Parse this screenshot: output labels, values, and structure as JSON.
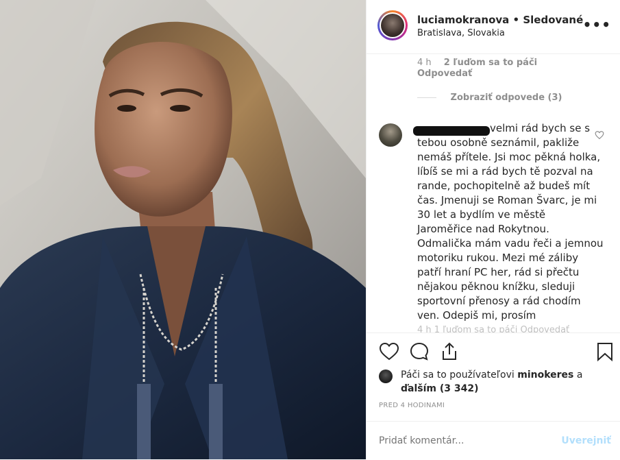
{
  "post": {
    "username": "luciamokranova",
    "separator": "•",
    "follow_status": "Sledované",
    "location": "Bratislava, Slovakia",
    "more_label": "•••"
  },
  "comments": {
    "prev_time": "4 h",
    "prev_likes": "2 ľuďom sa to páči",
    "reply_label": "Odpovedať",
    "view_replies": "Zobraziť odpovede (3)",
    "main_comment": "velmi rád bych se s tebou osobně seznámil, pakliže nemáš přítele. Jsi moc pěkná holka, líbíš se mi a rád bych tě pozval na rande, pochopitelně až budeš mít čas. Jmenuji se Roman Švarc, je mi 30 let a bydlím ve městě Jaroměřice nad Rokytnou. Odmalička mám vadu řeči a jemnou motoriku rukou. Mezi mé záliby patří hraní PC her, rád si přečtu nějakou pěknou knížku, sleduji sportovní přenosy a rád chodím ven. Odepiš mi, prosím",
    "faded_row": "4 h   1 ľuďom sa to páči   Odpovedať"
  },
  "likes": {
    "prefix": "Páči sa to používateľovi ",
    "user": "minokeres",
    "middle": " a ",
    "others": "ďalším (3 342)"
  },
  "timestamp": "PRED 4 HODINAMI",
  "composer": {
    "placeholder": "Pridať komentár...",
    "post_label": "Uverejniť"
  },
  "colors": {
    "text": "#262626",
    "muted": "#8e8e8e",
    "post_disabled": "#b2dffc",
    "border": "#efefef"
  },
  "icons": [
    "heart-icon",
    "comment-icon",
    "share-icon",
    "bookmark-icon",
    "more-icon"
  ]
}
